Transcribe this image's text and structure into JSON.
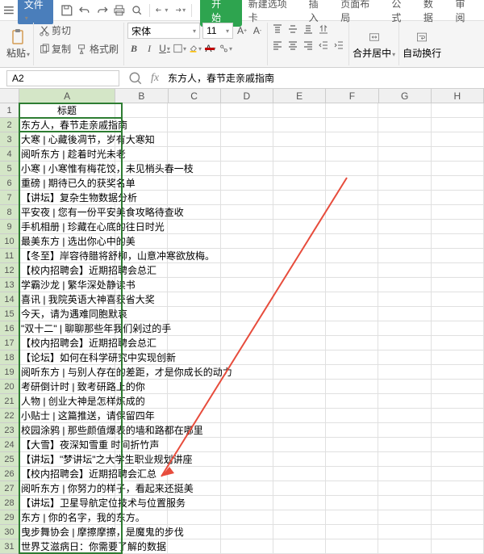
{
  "menubar": {
    "file_label": "文件",
    "start_label": "开始",
    "tabs": [
      "新建选项卡",
      "插入",
      "页面布局",
      "公式",
      "数据",
      "审阅"
    ]
  },
  "ribbon": {
    "paste_label": "粘贴",
    "cut_label": "剪切",
    "copy_label": "复制",
    "format_painter_label": "格式刷",
    "font_name": "宋体",
    "font_size": "11",
    "merge_center_label": "合并居中",
    "auto_wrap_label": "自动换行"
  },
  "name_box": "A2",
  "formula_bar": "东方人，春节走亲戚指南",
  "columns": [
    "A",
    "B",
    "C",
    "D",
    "E",
    "F",
    "G",
    "H"
  ],
  "header_cell": "标题",
  "rows": [
    "东方人，春节走亲戚指南",
    "大寒   |   心藏後凋节，岁有大寒知",
    "阅听东方   |   趁着时光未老",
    "小寒   |   小寒惟有梅花饺，未见梢头春一枝",
    "重磅   |   期待已久的获奖名单",
    "【讲坛】复杂生物数据分析",
    "平安夜   |   您有一份平安美食攻略待查收",
    "手机相册   |   珍藏在心底的往日时光",
    "最美东方   |   选出你心中的美",
    "【冬至】岸容待腊将舒柳，山意冲寒欲放梅。",
    "【校内招聘会】近期招聘会总汇",
    "学霸沙龙   |   繁华深处静读书",
    "喜讯 | 我院英语大神喜获省大奖",
    "今天，请为遇难同胞默哀",
    "\"双十二\" | 聊聊那些年我们剁过的手",
    "【校内招聘会】近期招聘会总汇",
    "【论坛】如何在科学研究中实现创新",
    "阅听东方   |   与别人存在的差距，才是你成长的动力",
    "考研倒计时   |   致考研路上的你",
    "人物   |   创业大神是怎样炼成的",
    "小贴士   |   这篇推送，请保留四年",
    "校园涂鸦   |   那些颜值爆表的墙和路都在哪里",
    "【大雪】夜深知雪重 时间折竹声",
    "【讲坛】\"梦讲坛\"之大学生职业规划讲座",
    "【校内招聘会】近期招聘会汇总",
    "阅听东方   |   你努力的样子，看起来还挺美",
    "【讲坛】卫星导航定位技术与位置服务",
    "东方 | 你的名字，我的东方。",
    "曳步舞协会   |   摩擦摩擦，是魔鬼的步伐",
    "世界艾滋病日：你需要了解的数据"
  ]
}
